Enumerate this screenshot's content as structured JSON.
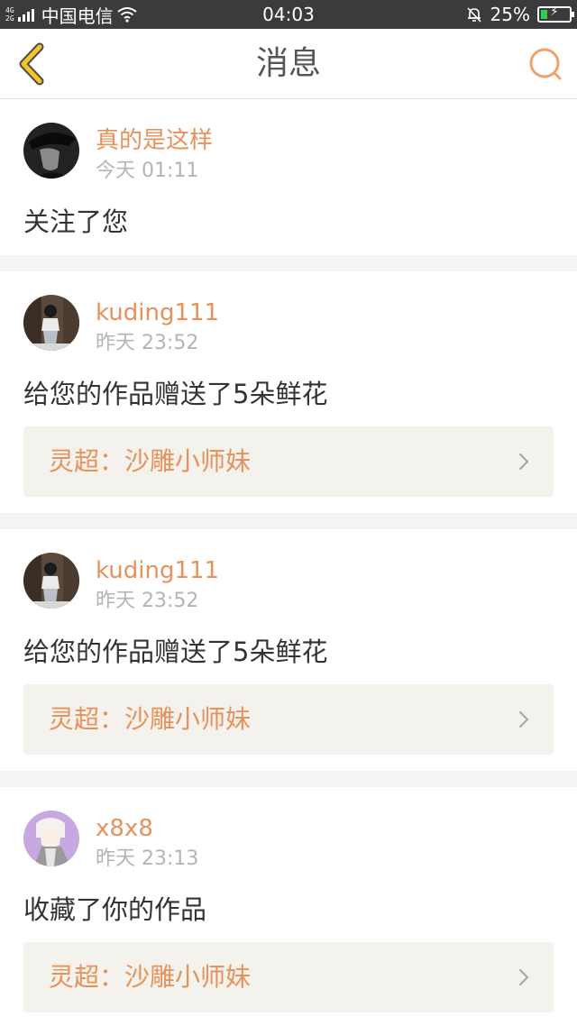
{
  "status_bar": {
    "net_top": "4G",
    "net_bottom": "2G",
    "carrier": "中国电信",
    "time": "04:03",
    "battery_pct": "25%",
    "battery_level": 0.25
  },
  "header": {
    "title": "消息"
  },
  "notifications": [
    {
      "username": "真的是这样",
      "time": "今天 01:11",
      "message": "关注了您",
      "avatar": "dark-avatar"
    },
    {
      "username": "kuding111",
      "time": "昨天 23:52",
      "message": "给您的作品赠送了5朵鲜花",
      "work_title": "灵超：沙雕小师妹",
      "avatar": "photo-avatar"
    },
    {
      "username": "kuding111",
      "time": "昨天 23:52",
      "message": "给您的作品赠送了5朵鲜花",
      "work_title": "灵超：沙雕小师妹",
      "avatar": "photo-avatar"
    },
    {
      "username": "x8x8",
      "time": "昨天 23:13",
      "message": "收藏了你的作品",
      "work_title": "灵超：沙雕小师妹",
      "avatar": "anime-avatar"
    }
  ],
  "colors": {
    "accent": "#e8915a",
    "back_arrow": "#f5c32c",
    "status_bar_bg": "#3b3b3b",
    "work_link_bg": "#f3f2ec"
  }
}
